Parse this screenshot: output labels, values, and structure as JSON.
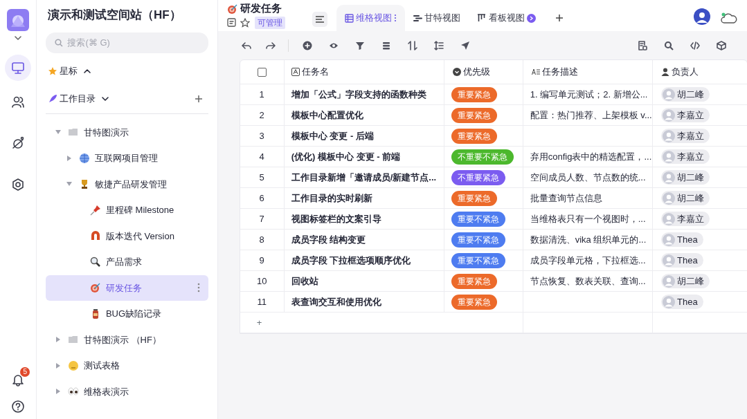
{
  "space": {
    "title": "演示和测试空间站（HF）",
    "search_placeholder": "搜索(⌘ G)",
    "notification_count": "5"
  },
  "starred": {
    "label": "星标",
    "expanded": true
  },
  "workdir": {
    "label": "工作目录",
    "expanded": true
  },
  "tree": [
    {
      "label": "甘特图演示",
      "kind": "folder",
      "expanded": true,
      "selected": false,
      "children": [
        {
          "label": "互联网项目管理",
          "kind": "globe",
          "expanded": false,
          "selected": false
        },
        {
          "label": "敏捷产品研发管理",
          "kind": "trophy",
          "expanded": true,
          "selected": false,
          "children": [
            {
              "label": "里程碑 Milestone",
              "kind": "pin",
              "selected": false
            },
            {
              "label": "版本迭代 Version",
              "kind": "magnet",
              "selected": false
            },
            {
              "label": "产品需求",
              "kind": "magnifier",
              "selected": false
            },
            {
              "label": "研发任务",
              "kind": "target",
              "selected": true
            },
            {
              "label": "BUG缺陷记录",
              "kind": "bottle",
              "selected": false
            }
          ]
        }
      ]
    },
    {
      "label": "甘特图演示 （HF）",
      "kind": "folder",
      "expanded": false,
      "selected": false
    },
    {
      "label": "测试表格",
      "kind": "face",
      "expanded": false,
      "selected": false
    },
    {
      "label": "维格表演示",
      "kind": "eyes",
      "expanded": false,
      "selected": false
    }
  ],
  "sheet": {
    "title": "研发任务",
    "permission": "可管理"
  },
  "tabs": [
    {
      "label": "维格视图",
      "kind": "grid",
      "selected": true
    },
    {
      "label": "甘特视图",
      "kind": "gantt",
      "selected": false
    },
    {
      "label": "看板视图",
      "kind": "kanban",
      "selected": false
    }
  ],
  "table": {
    "columns": [
      {
        "label": "任务名",
        "kind": "text"
      },
      {
        "label": "优先级",
        "kind": "select"
      },
      {
        "label": "任务描述",
        "kind": "longtext"
      },
      {
        "label": "负责人",
        "kind": "member"
      }
    ],
    "rows": [
      {
        "no": "1",
        "name": "增加「公式」字段支持的函数种类",
        "priority": {
          "label": "重要紧急",
          "color": "#ec6a2a"
        },
        "desc": "1. 编写单元测试；2. 新增公...",
        "owner": "胡二峰"
      },
      {
        "no": "2",
        "name": "模板中心配置优化",
        "priority": {
          "label": "重要紧急",
          "color": "#ec6a2a"
        },
        "desc": "配置：热门推荐、上架模板 v...",
        "owner": "李嘉立"
      },
      {
        "no": "3",
        "name": "模板中心 变更 - 后端",
        "priority": {
          "label": "重要紧急",
          "color": "#ec6a2a"
        },
        "owner": "李嘉立"
      },
      {
        "no": "4",
        "name": "(优化) 模板中心 变更 - 前端",
        "priority": {
          "label": "不重要不紧急",
          "color": "#4cb82d"
        },
        "desc": "弃用config表中的精选配置，...",
        "owner": "李嘉立"
      },
      {
        "no": "5",
        "name": "工作目录新增「邀请成员/新建节点...",
        "priority": {
          "label": "不重要紧急",
          "color": "#7b5cf0"
        },
        "desc": "空间成员人数、节点数的统...",
        "owner": "胡二峰"
      },
      {
        "no": "6",
        "name": "工作目录的实时刷新",
        "priority": {
          "label": "重要紧急",
          "color": "#ec6a2a"
        },
        "desc": "批量查询节点信息",
        "owner": "胡二峰"
      },
      {
        "no": "7",
        "name": "视图标签栏的文案引导",
        "priority": {
          "label": "重要不紧急",
          "color": "#4e7cf0"
        },
        "desc": "当维格表只有一个视图时，...",
        "owner": "李嘉立"
      },
      {
        "no": "8",
        "name": "成员字段 结构变更",
        "priority": {
          "label": "重要不紧急",
          "color": "#4e7cf0"
        },
        "desc": "数据清洗、vika 组织单元的...",
        "owner": "Thea"
      },
      {
        "no": "9",
        "name": "成员字段 下拉框选项顺序优化",
        "priority": {
          "label": "重要不紧急",
          "color": "#4e7cf0"
        },
        "desc": "成员字段单元格，下拉框选...",
        "owner": "Thea"
      },
      {
        "no": "10",
        "name": "回收站",
        "priority": {
          "label": "重要紧急",
          "color": "#ec6a2a"
        },
        "desc": "节点恢复、数表关联、查询...",
        "owner": "胡二峰"
      },
      {
        "no": "11",
        "name": "表查询交互和使用优化",
        "priority": {
          "label": "重要紧急",
          "color": "#ec6a2a"
        },
        "owner": "Thea"
      }
    ],
    "add_row": "+",
    "select_all": {
      "checked": false
    }
  }
}
